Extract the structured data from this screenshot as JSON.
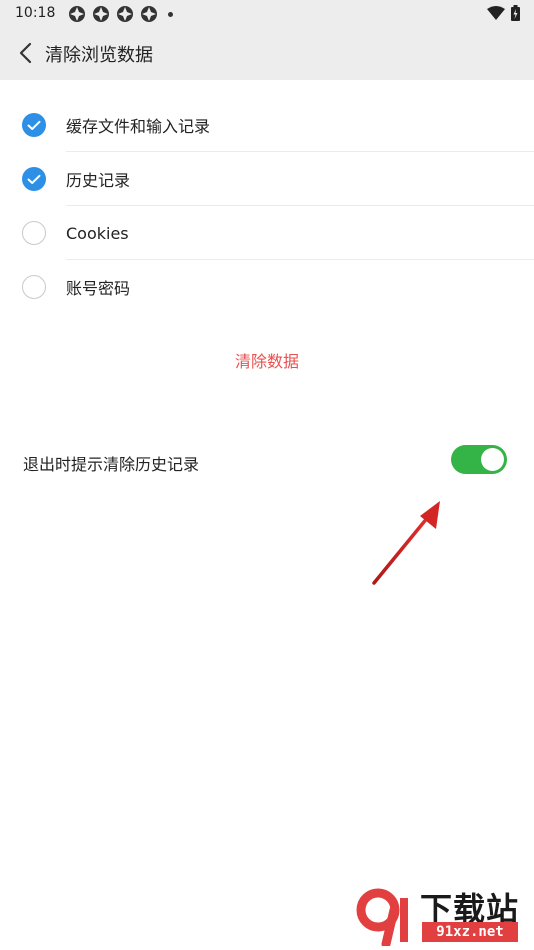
{
  "status_bar": {
    "time": "10:18"
  },
  "header": {
    "title": "清除浏览数据"
  },
  "options": [
    {
      "label": "缓存文件和输入记录",
      "checked": true
    },
    {
      "label": "历史记录",
      "checked": true
    },
    {
      "label": "Cookies",
      "checked": false
    },
    {
      "label": "账号密码",
      "checked": false
    }
  ],
  "clear_button": {
    "label": "清除数据"
  },
  "exit_prompt": {
    "label": "退出时提示清除历史记录",
    "enabled": true
  },
  "watermark": {
    "title": "下载站",
    "url": "91xz.net"
  },
  "colors": {
    "accent_blue": "#2e8fe6",
    "clear_red": "#e8504f",
    "toggle_green": "#34b347",
    "arrow_red": "#d42525"
  }
}
